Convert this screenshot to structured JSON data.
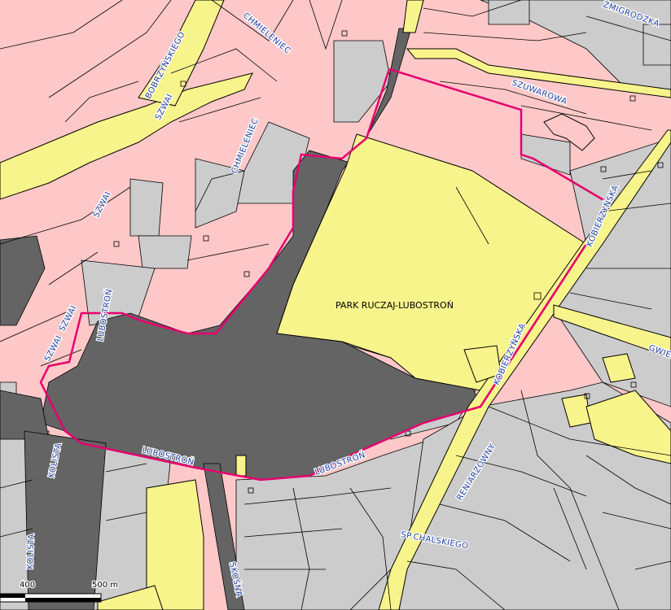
{
  "map": {
    "park_label": "PARK RUCZAJ-LUBOSTROŃ",
    "streets": {
      "zmigrodzka": "ŻMIGRODZKA",
      "bobrzynskiego": "BOBRZYŃSKIEGO",
      "szwai_a": "SZWAI",
      "szwai_b": "SZWAI",
      "szwai_c": "SZWAI",
      "szwai_d": "SZWAI",
      "chmieleniec_a": "CHMIELENIEC",
      "chmieleniec_b": "CHMIELENIEC",
      "szuwarowa": "SZUWAROWA",
      "kobierzynska_a": "KOBIERZYŃSKA",
      "kobierzynska_b": "KOBIERZYŃSKA",
      "gwiezdna": "GWIEZDNA",
      "lubostron_a": "LUBOSTROŃ",
      "lubostron_b": "LUBOSTROŃ",
      "lubostron_c": "LUBOSTROŃ",
      "kolista_a": "KOLISTA",
      "kolista_b": "KOLISTA",
      "skosna": "SKOŚNA",
      "reniarzowny": "RENIARZOWNY",
      "sp_chalskiego": "SP.CHALSKIEGO"
    },
    "scale": {
      "zero": "400",
      "end": "500 m"
    },
    "colors": {
      "background_parcel": "#ffc8c8",
      "park": "#f8f48c",
      "road_yellow": "#f8f48c",
      "building": "#cccccc",
      "dark_area": "#646464",
      "boundary": "#e6006e",
      "street_text": "#1f3f9f"
    }
  }
}
